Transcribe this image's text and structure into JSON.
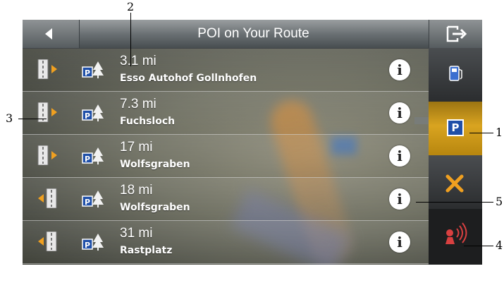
{
  "header": {
    "title": "POI on Your Route"
  },
  "rows": [
    {
      "distance": "3.1 mi",
      "name": "Esso Autohof Gollnhofen",
      "lane_side": "right"
    },
    {
      "distance": "7.3 mi",
      "name": "Fuchsloch",
      "lane_side": "right"
    },
    {
      "distance": "17 mi",
      "name": "Wolfsgraben",
      "lane_side": "right"
    },
    {
      "distance": "18 mi",
      "name": "Wolfsgraben",
      "lane_side": "left"
    },
    {
      "distance": "31 mi",
      "name": "Rastplatz",
      "lane_side": "left"
    }
  ],
  "info_glyph": "i",
  "sidebar": {
    "items": [
      {
        "icon": "fuel-icon",
        "active": false
      },
      {
        "icon": "parking-icon",
        "label": "P",
        "active": true
      },
      {
        "icon": "tools-icon",
        "active": false
      },
      {
        "icon": "sound-icon",
        "active": false
      }
    ]
  },
  "callouts": [
    "1",
    "2",
    "3",
    "4",
    "5"
  ],
  "colors": {
    "accent": "#d9a420",
    "lane_arrow": "#f0a020",
    "parking_blue": "#1f4fa8"
  }
}
